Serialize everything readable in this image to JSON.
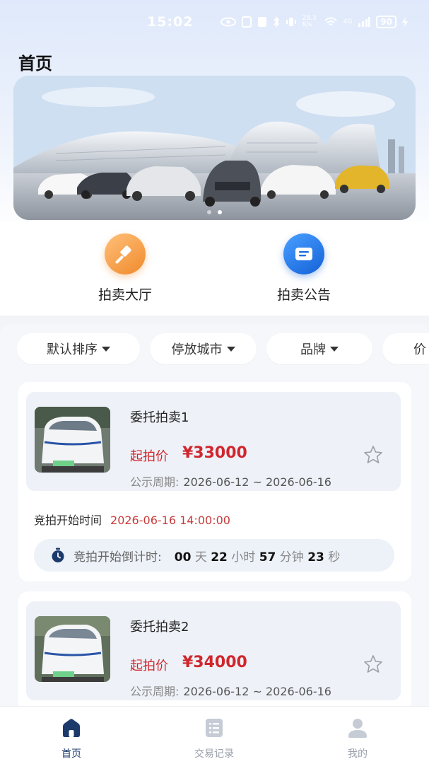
{
  "status_bar": {
    "time": "15:02",
    "net_speed": "28.3 K/s",
    "signal": "4G",
    "battery": "90"
  },
  "page": {
    "title": "首页"
  },
  "banner": {
    "dots": 2,
    "active_dot": 2
  },
  "quick_actions": [
    {
      "label": "拍卖大厅",
      "icon": "gavel-icon",
      "color": "#f59a3c"
    },
    {
      "label": "拍卖公告",
      "icon": "announcement-icon",
      "color": "#1f6fe0"
    }
  ],
  "filters": [
    {
      "label": "默认排序"
    },
    {
      "label": "停放城市"
    },
    {
      "label": "品牌"
    },
    {
      "label": "价"
    }
  ],
  "listings": [
    {
      "title": "委托拍卖1",
      "price_label": "起拍价",
      "price": "¥33000",
      "period_label": "公示周期:",
      "period": "2026-06-12 ~ 2026-06-16",
      "start_label": "竞拍开始时间",
      "start_time": "2026-06-16 14:00:00",
      "countdown_label": "竞拍开始倒计时:",
      "countdown": {
        "days": "00",
        "days_unit": "天",
        "hours": "22",
        "hours_unit": "小时",
        "minutes": "57",
        "minutes_unit": "分钟",
        "seconds": "23",
        "seconds_unit": "秒"
      }
    },
    {
      "title": "委托拍卖2",
      "price_label": "起拍价",
      "price": "¥34000",
      "period_label": "公示周期:",
      "period": "2026-06-12 ~ 2026-06-16"
    }
  ],
  "tabbar": [
    {
      "label": "首页",
      "icon": "home-icon",
      "active": true
    },
    {
      "label": "交易记录",
      "icon": "list-icon",
      "active": false
    },
    {
      "label": "我的",
      "icon": "user-icon",
      "active": false
    }
  ],
  "colors": {
    "accent": "#1b3a6b",
    "price": "#d0262d",
    "orange": "#f59a3c",
    "blue": "#1f6fe0"
  }
}
